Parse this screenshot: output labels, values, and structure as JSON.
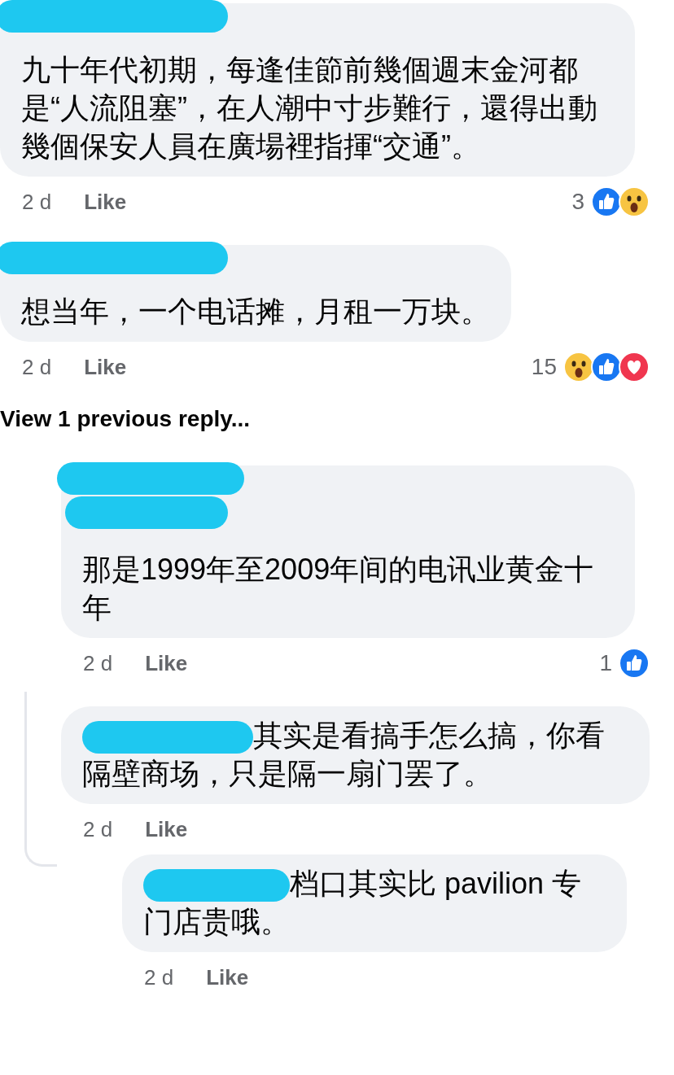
{
  "comments": [
    {
      "name_inline": false,
      "text": "九十年代初期，每逢佳節前幾個週末金河都是“人流阻塞”，在人潮中寸步難行，還得出動幾個保安人員在廣場裡指揮“交通”。",
      "time": "2 d",
      "like": "Like",
      "reaction_count": "3",
      "reactions": [
        {
          "kind": "like"
        },
        {
          "kind": "wow"
        }
      ]
    },
    {
      "name_inline": false,
      "text": "想当年，一个电话摊，月租一万块。",
      "time": "2 d",
      "like": "Like",
      "reaction_count": "15",
      "reactions": [
        {
          "kind": "wow"
        },
        {
          "kind": "like"
        },
        {
          "kind": "love"
        }
      ],
      "view_previous": "View 1 previous reply...",
      "replies": [
        {
          "name_inline": false,
          "text": "那是1999年至2009年间的电讯业黄金十年",
          "time": "2 d",
          "like": "Like",
          "reaction_count": "1",
          "reactions": [
            {
              "kind": "like"
            }
          ]
        },
        {
          "name_inline": true,
          "text": "其实是看搞手怎么搞，你看隔壁商场，只是隔一扇门罢了。",
          "time": "2 d",
          "like": "Like",
          "replies": [
            {
              "name_inline": true,
              "text": "档口其实比 pavilion 专门店贵哦。",
              "time": "2 d",
              "like": "Like"
            }
          ]
        }
      ]
    }
  ]
}
